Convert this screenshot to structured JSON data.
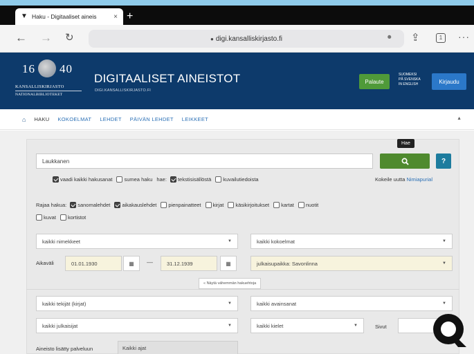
{
  "browser": {
    "tab_title": "Haku - Digitaaliset aineis",
    "tab_close": "×",
    "new_tab": "+",
    "url": "digi.kansalliskirjasto.fi",
    "tab_count": "1",
    "more": "···"
  },
  "header": {
    "logo_year_left": "16",
    "logo_year_right": "40",
    "logo_line1": "KANSALLISKIRJASTO",
    "logo_line2": "NATIONALBIBLIOTEKET",
    "title": "DIGITAALISET AINEISTOT",
    "subtitle": "DIGI.KANSALLISKIRJASTO.FI",
    "feedback_label": "Palaute",
    "lang_line1": "SUOMEKSI",
    "lang_line2": "PÅ SVENSKA",
    "lang_line3": "IN ENGLISH",
    "login_label": "Kirjaudu"
  },
  "nav": {
    "items": [
      "HAKU",
      "KOKOELMAT",
      "LEHDET",
      "PÄIVÄN LEHDET",
      "LEIKKEET"
    ]
  },
  "search": {
    "query": "Laukkanen",
    "tooltip": "Hae",
    "help": "?",
    "options": {
      "require_all": "vaadi kaikki hakusanat",
      "fuzzy": "sumea haku",
      "search_in_label": "hae:",
      "text_content": "tekstisisällöstä",
      "image_descriptions": "kuvailutiedoista",
      "try_new_prefix": "Kokeile uutta",
      "try_new_link": "Nimiapurial"
    }
  },
  "filters": {
    "restrict_label": "Rajaa hakua:",
    "types": [
      "sanomalehdet",
      "aikakauslehdet",
      "pienpainatteet",
      "kirjat",
      "käsikirjoitukset",
      "kartat",
      "nuotit"
    ],
    "types_row2": [
      "kuvat",
      "kortistot"
    ],
    "titles_select": "kaikki nimekkeet",
    "collections_select": "kaikki kokoelmat",
    "period_label": "Aikaväli",
    "date_from": "01.01.1930",
    "date_to": "31.12.1939",
    "date_dash": "—",
    "place_select": "julkaisupaikka: Savonlinna",
    "less_options": "« Näytä vähemmän hakuehtoja",
    "authors_select": "kaikki tekijät (kirjat)",
    "keywords_select": "kaikki avainsanat",
    "publishers_select": "kaikki julkaisijat",
    "languages_select": "kaikki kielet",
    "pages_label": "Sivut",
    "added_label": "Aineisto lisätty palveluun",
    "added_select": "Kaikki ajat"
  }
}
